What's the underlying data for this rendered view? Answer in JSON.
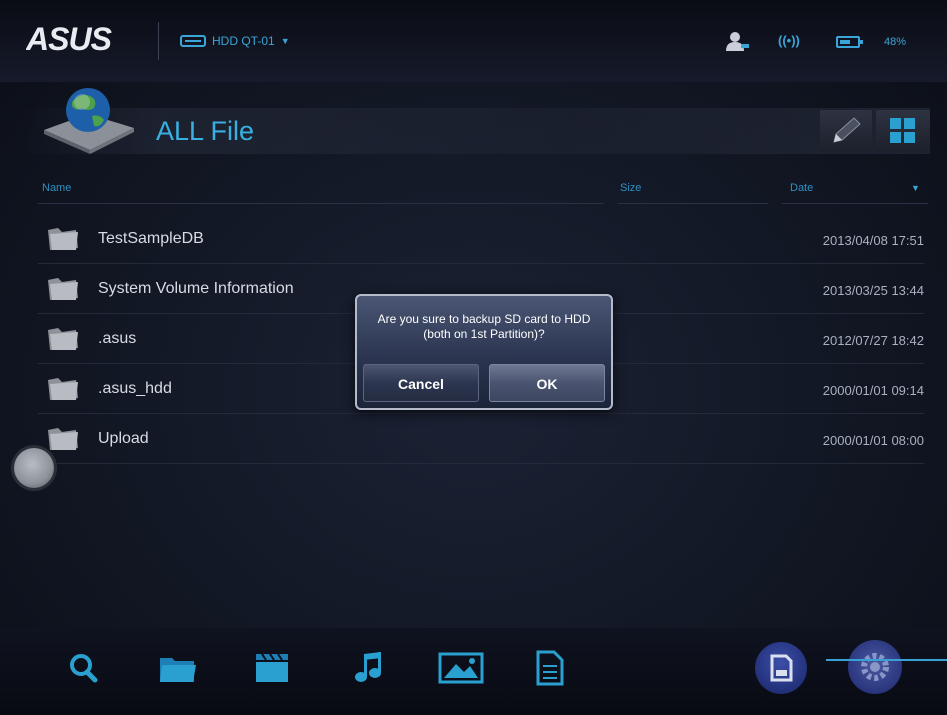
{
  "app": {
    "brand": "ASUS",
    "device_name": "HDD QT-01",
    "battery_percent": "48%"
  },
  "header": {
    "title": "ALL File"
  },
  "columns": {
    "name": "Name",
    "size": "Size",
    "date": "Date"
  },
  "files": [
    {
      "name": "TestSampleDB",
      "date": "2013/04/08 17:51"
    },
    {
      "name": "System Volume Information",
      "date": "2013/03/25 13:44"
    },
    {
      "name": ".asus",
      "date": "2012/07/27 18:42"
    },
    {
      "name": ".asus_hdd",
      "date": "2000/01/01 09:14"
    },
    {
      "name": "Upload",
      "date": "2000/01/01 08:00"
    }
  ],
  "dialog": {
    "message": "Are you sure to backup SD card to HDD (both on 1st Partition)?",
    "cancel_label": "Cancel",
    "ok_label": "OK"
  },
  "bottom_nav": {
    "icons": [
      "search-icon",
      "folder-icon",
      "video-icon",
      "music-icon",
      "image-icon",
      "document-icon",
      "sd-backup-icon",
      "settings-icon"
    ]
  },
  "colors": {
    "accent": "#3ab0e2",
    "background": "#121724",
    "dialog": "#2b3550"
  }
}
